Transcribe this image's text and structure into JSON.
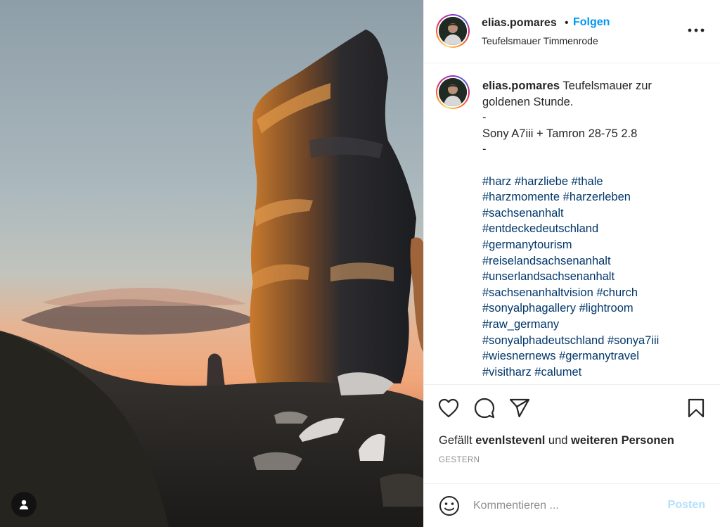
{
  "post": {
    "username": "elias.pomares",
    "separator": "•",
    "follow_label": "Folgen",
    "location": "Teufelsmauer Timmenrode"
  },
  "caption": {
    "username": "elias.pomares",
    "text_line1": " Teufelsmauer zur",
    "text_line2": "goldenen Stunde.",
    "dash1": "-",
    "gear": "Sony A7iii + Tamron 28-75 2.8",
    "dash2": "-",
    "hashtag_lines": [
      "#harz #harzliebe #thale",
      "#harzmomente #harzerleben",
      "#sachsenanhalt",
      "#entdeckedeutschland",
      "#germanytourism",
      "#reiselandsachsenanhalt",
      "#unserlandsachsenanhalt",
      "#sachsenanhaltvision #church",
      "#sonyalphagallery #lightroom",
      "#raw_germany",
      "#sonyalphadeutschland #sonya7iii",
      "#wiesnernews #germanytravel",
      "#visitharz #calumet"
    ]
  },
  "likes": {
    "prefix": "Gefällt ",
    "user": "evenlstevenl",
    "middle": " und ",
    "rest": "weiteren Personen"
  },
  "date": "GESTERN",
  "comment": {
    "placeholder": "Kommentieren ...",
    "post_label": "Posten"
  },
  "icons": {
    "more": "more-options-icon",
    "like": "heart-icon",
    "comment": "comment-icon",
    "share": "paper-plane-icon",
    "save": "bookmark-icon",
    "emoji": "emoji-icon",
    "tagged": "user-icon"
  },
  "colors": {
    "link": "#0095f6",
    "hashtag": "#00376b",
    "post_disabled": "#b2dffc",
    "muted": "#8e8e8e"
  }
}
